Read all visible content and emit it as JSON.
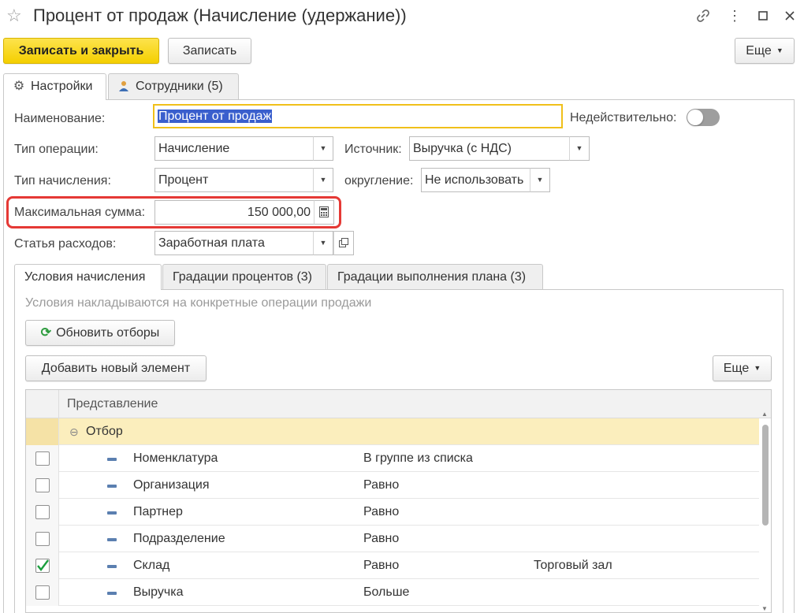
{
  "window": {
    "title": "Процент от продаж (Начисление (удержание))",
    "star_glyph": "☆",
    "link_glyph": "🔗",
    "more_glyph": "⋮",
    "maximize_glyph": "☐",
    "close_glyph": "✕"
  },
  "toolbar": {
    "save_close_label": "Записать и закрыть",
    "save_label": "Записать",
    "more_label": "Еще"
  },
  "tabs": [
    {
      "label": "Настройки",
      "icon": "gear-icon",
      "active": true
    },
    {
      "label": "Сотрудники (5)",
      "icon": "person-icon",
      "active": false
    }
  ],
  "form": {
    "name_label": "Наименование:",
    "name_value": "Процент от продаж",
    "invalid_label": "Недействительно:",
    "invalid_on": false,
    "operation_type_label": "Тип операции:",
    "operation_type_value": "Начисление",
    "source_label": "Источник:",
    "source_value": "Выручка (с НДС)",
    "accrual_type_label": "Тип начисления:",
    "accrual_type_value": "Процент",
    "rounding_label": "округление:",
    "rounding_value": "Не использовать",
    "max_sum_label": "Максимальная сумма:",
    "max_sum_value": "150 000,00",
    "expense_label": "Статья расходов:",
    "expense_value": "Заработная плата"
  },
  "inner_tabs": [
    {
      "label": "Условия начисления",
      "active": true
    },
    {
      "label": "Градации процентов (3)",
      "active": false
    },
    {
      "label": "Градации выполнения плана (3)",
      "active": false
    }
  ],
  "conditions": {
    "hint": "Условия накладываются на конкретные операции продажи",
    "refresh_label": "Обновить отборы",
    "add_label": "Добавить новый элемент",
    "more_label": "Еще"
  },
  "grid": {
    "header": "Представление",
    "group_label": "Отбор",
    "rows": [
      {
        "field": "Номенклатура",
        "condition": "В группе из списка",
        "value": "",
        "checked": false
      },
      {
        "field": "Организация",
        "condition": "Равно",
        "value": "",
        "checked": false
      },
      {
        "field": "Партнер",
        "condition": "Равно",
        "value": "",
        "checked": false
      },
      {
        "field": "Подразделение",
        "condition": "Равно",
        "value": "",
        "checked": false
      },
      {
        "field": "Склад",
        "condition": "Равно",
        "value": "Торговый зал",
        "checked": true
      },
      {
        "field": "Выручка",
        "condition": "Больше",
        "value": "",
        "checked": false
      }
    ]
  },
  "colors": {
    "primary_button": "#f4cf00",
    "highlight": "#e53935",
    "group_row": "#fbeebd",
    "check_mark": "#1b9e3e"
  }
}
